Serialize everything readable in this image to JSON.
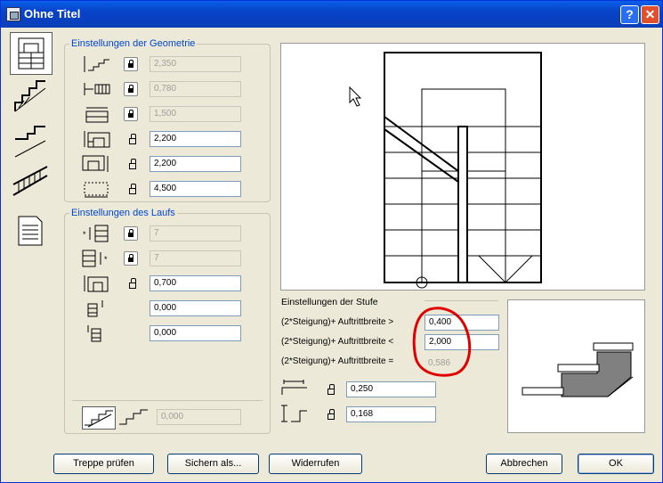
{
  "window": {
    "title": "Ohne Titel",
    "help_label": "?",
    "close_label": "✕"
  },
  "geometry": {
    "label": "Einstellungen der Geometrie",
    "rows": [
      {
        "value": "2,350",
        "locked": true
      },
      {
        "value": "0,780",
        "locked": true
      },
      {
        "value": "1,500",
        "locked": true
      },
      {
        "value": "2,200",
        "locked": false
      },
      {
        "value": "2,200",
        "locked": false
      },
      {
        "value": "4,500",
        "locked": false
      }
    ]
  },
  "flight": {
    "label": "Einstellungen des Laufs",
    "rows": [
      {
        "value": "7",
        "locked": true
      },
      {
        "value": "7",
        "locked": true
      },
      {
        "value": "0,700",
        "locked": false
      },
      {
        "value": "0,000"
      },
      {
        "value": "0,000"
      }
    ],
    "bottom_value": "0,000"
  },
  "step": {
    "label": "Einstellungen der Stufe",
    "row1_label": "(2*Steigung)+ Auftrittbreite >",
    "row1_value": "0,400",
    "row2_label": "(2*Steigung)+ Auftrittbreite <",
    "row2_value": "2,000",
    "row3_label": "(2*Steigung)+ Auftrittbreite =",
    "row3_value": "0,586",
    "tread_value": "0,250",
    "riser_value": "0,168"
  },
  "buttons": {
    "check": "Treppe prüfen",
    "save_as": "Sichern als...",
    "revoke": "Widerrufen",
    "cancel": "Abbrechen",
    "ok": "OK"
  },
  "colors": {
    "annotation": "#e00000",
    "group_label": "#0046d5"
  }
}
